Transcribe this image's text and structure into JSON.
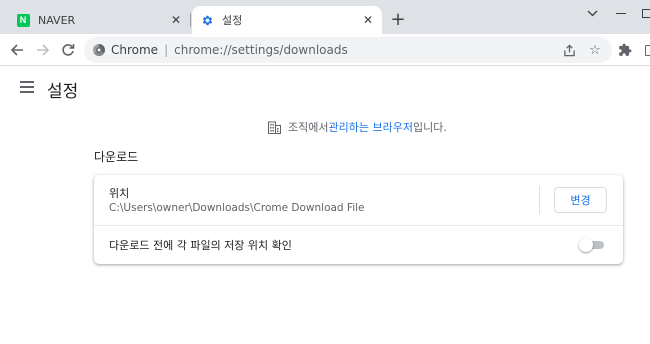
{
  "tabs": [
    {
      "title": "NAVER",
      "favicon": "naver-logo-icon",
      "favicon_letter": "N",
      "active": false
    },
    {
      "title": "설정",
      "favicon": "settings-gear-icon",
      "active": true
    }
  ],
  "toolbar": {
    "origin_label": "Chrome",
    "separator": "|",
    "url": "chrome://settings/downloads"
  },
  "settings": {
    "title": "설정",
    "managed_notice": {
      "prefix": "조직에서 ",
      "link": "관리하는 브라우저",
      "suffix": "입니다."
    },
    "downloads": {
      "section_title": "다운로드",
      "location_label": "위치",
      "location_path": "C:\\Users\\owner\\Downloads\\Crome Download File",
      "change_button": "변경",
      "ask_label": "다운로드 전에 각 파일의 저장 위치 확인",
      "ask_enabled": false
    }
  },
  "colors": {
    "accent": "#1a73e8",
    "tabstrip": "#dee1e6",
    "naver_green": "#03c75a"
  }
}
